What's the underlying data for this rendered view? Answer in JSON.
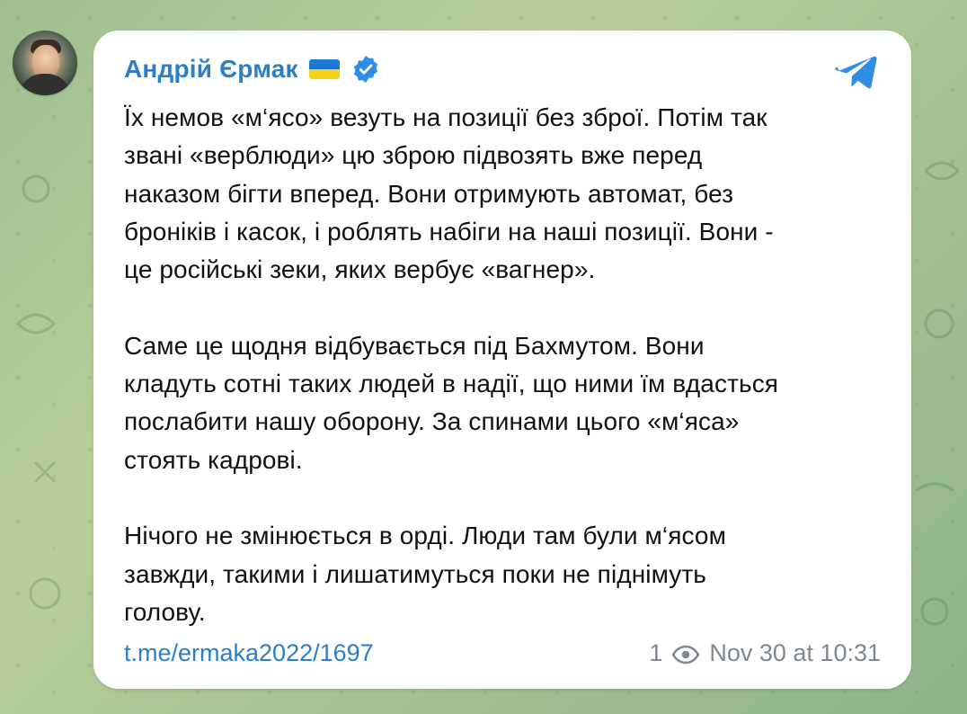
{
  "post": {
    "author": "Андрій Єрмак",
    "flag": "🇺🇦",
    "text": "Їх немов «м‘ясо» везуть на позиції без зброї. Потім так\nзвані «верблюди» цю зброю підвозять вже перед\nнаказом бігти вперед. Вони отримують автомат, без\nброніків і касок, і роблять набіги на наші позиції. Вони -\nце російські зеки, яких вербує «вагнер».\n\nСаме це щодня відбувається під Бахмутом. Вони\nкладуть сотні таких людей в надії, що ними їм вдасться\nпослабити нашу оборону. За спинами цього «м‘яса»\nстоять кадрові.\n\nНічого не змінюється в орді. Люди там були м‘ясом\nзавжди, такими і лишатимуться поки не піднімуть\nголову.",
    "link": "t.me/ermaka2022/1697",
    "views": "1",
    "timestamp": "Nov 30 at 10:31"
  },
  "icons": {
    "verified": "verified-badge-icon",
    "telegram": "telegram-icon",
    "views": "eye-icon"
  },
  "colors": {
    "author": "#2b7fc9",
    "link": "#2b7fc9",
    "meta": "#7f8790",
    "bubble": "#ffffff",
    "verified": "#2f8de4",
    "telegram": "#2f8de4"
  }
}
